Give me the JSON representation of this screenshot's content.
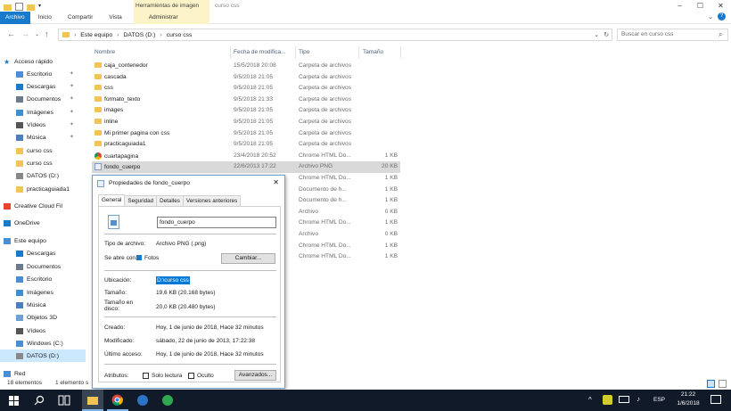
{
  "colors": {
    "ribbon_file": "#1979ca",
    "ctx_tab": "#fcf3c8",
    "taskbar": "#101a28",
    "selection": "#d9d9d9",
    "folder": "#f1c453",
    "link": "#4c607a"
  },
  "ribbon": {
    "context_group": "Herramientas de imagen",
    "window_title": "curso css",
    "tabs": [
      "Archivo",
      "Inicio",
      "Compartir",
      "Vista",
      "Administrar"
    ]
  },
  "address": {
    "path": [
      "Este equipo",
      "DATOS (D:)",
      "curso css"
    ],
    "search_placeholder": "Buscar en curso css"
  },
  "nav": [
    {
      "label": "Acceso rápido",
      "icon": "star-icon",
      "pin": false
    },
    {
      "label": "Escritorio",
      "icon": "desktop-icon",
      "pin": true
    },
    {
      "label": "Descargas",
      "icon": "download-icon",
      "pin": true
    },
    {
      "label": "Documentos",
      "icon": "documents-icon",
      "pin": true
    },
    {
      "label": "Imágenes",
      "icon": "pictures-icon",
      "pin": true
    },
    {
      "label": "Vídeos",
      "icon": "videos-icon",
      "pin": true
    },
    {
      "label": "Música",
      "icon": "music-icon",
      "pin": true
    },
    {
      "label": "curso css",
      "icon": "folder-icon",
      "pin": false
    },
    {
      "label": "curso css",
      "icon": "folder-icon",
      "pin": false
    },
    {
      "label": "DATOS (D:)",
      "icon": "drive-icon",
      "pin": false
    },
    {
      "label": "practicaguiada1",
      "icon": "folder-icon",
      "pin": false
    },
    {
      "label": "Creative Cloud Fil",
      "icon": "creative-cloud-icon",
      "pin": false
    },
    {
      "label": "OneDrive",
      "icon": "onedrive-icon",
      "pin": false
    },
    {
      "label": "Este equipo",
      "icon": "computer-icon",
      "pin": false
    },
    {
      "label": "Descargas",
      "icon": "download-icon",
      "pin": false
    },
    {
      "label": "Documentos",
      "icon": "documents-icon",
      "pin": false
    },
    {
      "label": "Escritorio",
      "icon": "desktop-icon",
      "pin": false
    },
    {
      "label": "Imágenes",
      "icon": "pictures-icon",
      "pin": false
    },
    {
      "label": "Música",
      "icon": "music-icon",
      "pin": false
    },
    {
      "label": "Objetos 3D",
      "icon": "3d-objects-icon",
      "pin": false
    },
    {
      "label": "Vídeos",
      "icon": "videos-icon",
      "pin": false
    },
    {
      "label": "Windows (C:)",
      "icon": "windows-drive-icon",
      "pin": false
    },
    {
      "label": "DATOS (D:)",
      "icon": "drive-icon",
      "pin": false
    },
    {
      "label": "Red",
      "icon": "network-icon",
      "pin": false
    }
  ],
  "columns": [
    "Nombre",
    "Fecha de modifica...",
    "Tipo",
    "Tamaño"
  ],
  "files": [
    {
      "name": "caja_contenedor",
      "date": "15/5/2018 20:08",
      "type": "Carpeta de archivos",
      "size": "",
      "kind": "folder"
    },
    {
      "name": "cascada",
      "date": "9/5/2018 21:05",
      "type": "Carpeta de archivos",
      "size": "",
      "kind": "folder"
    },
    {
      "name": "css",
      "date": "9/5/2018 21:05",
      "type": "Carpeta de archivos",
      "size": "",
      "kind": "folder"
    },
    {
      "name": "formato_texto",
      "date": "9/5/2018 21:33",
      "type": "Carpeta de archivos",
      "size": "",
      "kind": "folder"
    },
    {
      "name": "images",
      "date": "9/5/2018 21:05",
      "type": "Carpeta de archivos",
      "size": "",
      "kind": "folder"
    },
    {
      "name": "inline",
      "date": "9/5/2018 21:05",
      "type": "Carpeta de archivos",
      "size": "",
      "kind": "folder"
    },
    {
      "name": "Mi primer pagina con css",
      "date": "9/5/2018 21:05",
      "type": "Carpeta de archivos",
      "size": "",
      "kind": "folder"
    },
    {
      "name": "practicaguiada1",
      "date": "9/5/2018 21:05",
      "type": "Carpeta de archivos",
      "size": "",
      "kind": "folder"
    },
    {
      "name": "cuartapagina",
      "date": "23/4/2018 20:52",
      "type": "Chrome HTML Do...",
      "size": "1 KB",
      "kind": "chrome"
    },
    {
      "name": "fondo_cuerpo",
      "date": "22/6/2013 17:22",
      "type": "Archivo PNG",
      "size": "20 KB",
      "kind": "png",
      "selected": true
    },
    {
      "name": "",
      "date": "",
      "type": "Chrome HTML Do...",
      "size": "1 KB",
      "kind": "hidden"
    },
    {
      "name": "",
      "date": "",
      "type": "Documento de h...",
      "size": "1 KB",
      "kind": "hidden"
    },
    {
      "name": "",
      "date": "",
      "type": "Documento de h...",
      "size": "1 KB",
      "kind": "hidden"
    },
    {
      "name": "",
      "date": "",
      "type": "Archivo",
      "size": "0 KB",
      "kind": "hidden"
    },
    {
      "name": "",
      "date": "",
      "type": "Chrome HTML Do...",
      "size": "1 KB",
      "kind": "hidden"
    },
    {
      "name": "",
      "date": "",
      "type": "Archivo",
      "size": "0 KB",
      "kind": "hidden"
    },
    {
      "name": "",
      "date": "",
      "type": "Chrome HTML Do...",
      "size": "1 KB",
      "kind": "hidden"
    },
    {
      "name": "",
      "date": "",
      "type": "Chrome HTML Do...",
      "size": "1 KB",
      "kind": "hidden"
    }
  ],
  "status": {
    "count": "18 elementos",
    "selected": "1 elemento s"
  },
  "dialog": {
    "title": "Propiedades de fondo_cuerpo",
    "tabs": [
      "General",
      "Seguridad",
      "Detalles",
      "Versiones anteriores"
    ],
    "filename": "fondo_cuerpo",
    "file_type_label": "Tipo de archivo:",
    "file_type": "Archivo PNG (.png)",
    "opens_with_label": "Se abre con:",
    "opens_with": "Fotos",
    "change_button": "Cambiar...",
    "location_label": "Ubicación:",
    "location": "D:\\curso css",
    "size_label": "Tamaño:",
    "size": "19,6 KB (20.168 bytes)",
    "size_on_disk_label": "Tamaño en disco:",
    "size_on_disk": "20,0 KB (20.480 bytes)",
    "created_label": "Creado:",
    "created": "Hoy, 1 de junio de 2018, Hace 32 minutos",
    "modified_label": "Modificado:",
    "modified": "sábado, 22 de junio de 2013, 17:22:38",
    "accessed_label": "Último acceso:",
    "accessed": "Hoy, 1 de junio de 2018, Hace 32 minutos",
    "attributes_label": "Atributos:",
    "readonly": "Solo lectura",
    "hidden": "Oculto",
    "advanced_button": "Avanzados..."
  },
  "taskbar": {
    "lang": "ESP",
    "time": "21:22",
    "date": "1/6/2018"
  }
}
